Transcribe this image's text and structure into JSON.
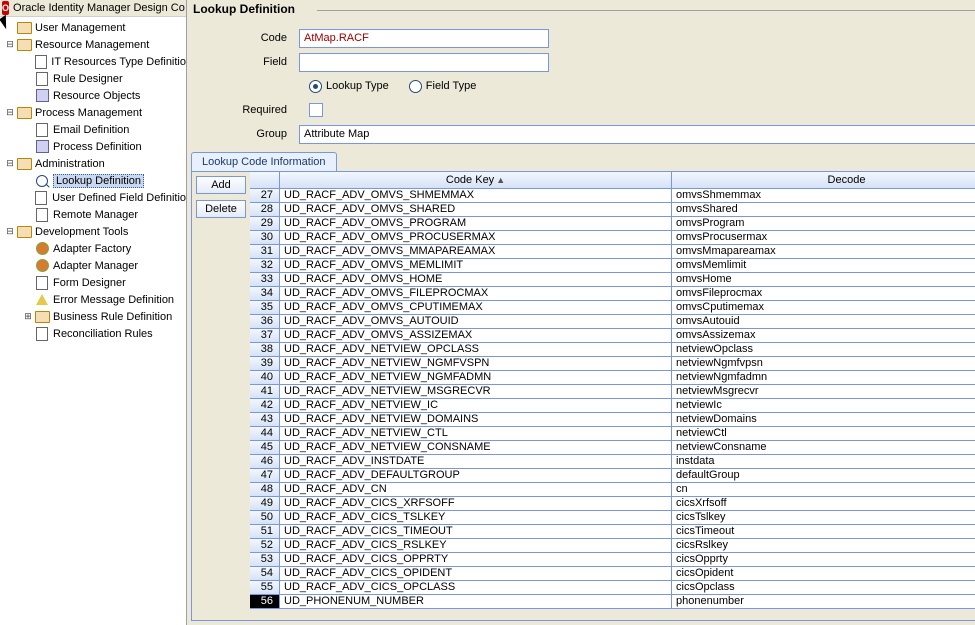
{
  "window": {
    "title": "Oracle Identity Manager Design Co"
  },
  "tree": [
    {
      "type": "folder",
      "label": "User Management",
      "depth": 0,
      "exp": ""
    },
    {
      "type": "folder",
      "label": "Resource Management",
      "depth": 0,
      "exp": "⊟"
    },
    {
      "type": "doc",
      "label": "IT Resources Type Definitio",
      "depth": 1,
      "exp": ""
    },
    {
      "type": "doc",
      "label": "Rule Designer",
      "depth": 1,
      "exp": ""
    },
    {
      "type": "generic",
      "label": "Resource Objects",
      "depth": 1,
      "exp": ""
    },
    {
      "type": "folder",
      "label": "Process Management",
      "depth": 0,
      "exp": "⊟"
    },
    {
      "type": "doc",
      "label": "Email Definition",
      "depth": 1,
      "exp": ""
    },
    {
      "type": "generic",
      "label": "Process Definition",
      "depth": 1,
      "exp": ""
    },
    {
      "type": "folder",
      "label": "Administration",
      "depth": 0,
      "exp": "⊟"
    },
    {
      "type": "magnify",
      "label": "Lookup Definition",
      "depth": 1,
      "exp": "",
      "selected": true
    },
    {
      "type": "doc",
      "label": "User Defined Field Definitio",
      "depth": 1,
      "exp": ""
    },
    {
      "type": "doc",
      "label": "Remote Manager",
      "depth": 1,
      "exp": ""
    },
    {
      "type": "folder",
      "label": "Development Tools",
      "depth": 0,
      "exp": "⊟"
    },
    {
      "type": "gear",
      "label": "Adapter Factory",
      "depth": 1,
      "exp": ""
    },
    {
      "type": "gear",
      "label": "Adapter Manager",
      "depth": 1,
      "exp": ""
    },
    {
      "type": "doc",
      "label": "Form Designer",
      "depth": 1,
      "exp": ""
    },
    {
      "type": "warn",
      "label": "Error Message Definition",
      "depth": 1,
      "exp": ""
    },
    {
      "type": "folder",
      "label": "Business Rule Definition",
      "depth": 1,
      "exp": "⊞"
    },
    {
      "type": "doc",
      "label": "Reconciliation Rules",
      "depth": 1,
      "exp": ""
    }
  ],
  "panel": {
    "title": "Lookup Definition",
    "labels": {
      "code": "Code",
      "field": "Field",
      "lookup_type": "Lookup Type",
      "field_type": "Field Type",
      "required": "Required",
      "group": "Group"
    },
    "values": {
      "code": "AtMap.RACF",
      "field": "",
      "type_selected": "lookup",
      "required": false,
      "group": "Attribute Map"
    },
    "tab": "Lookup Code Information",
    "buttons": {
      "add": "Add",
      "delete": "Delete"
    },
    "columns": {
      "codekey": "Code Key",
      "decode": "Decode",
      "sort": "▲"
    }
  },
  "rows": [
    {
      "n": 27,
      "k": "UD_RACF_ADV_OMVS_SHMEMMAX",
      "d": "omvsShmemmax"
    },
    {
      "n": 28,
      "k": "UD_RACF_ADV_OMVS_SHARED",
      "d": "omvsShared"
    },
    {
      "n": 29,
      "k": "UD_RACF_ADV_OMVS_PROGRAM",
      "d": "omvsProgram"
    },
    {
      "n": 30,
      "k": "UD_RACF_ADV_OMVS_PROCUSERMAX",
      "d": "omvsProcusermax"
    },
    {
      "n": 31,
      "k": "UD_RACF_ADV_OMVS_MMAPAREAMAX",
      "d": "omvsMmapareamax"
    },
    {
      "n": 32,
      "k": "UD_RACF_ADV_OMVS_MEMLIMIT",
      "d": "omvsMemlimit"
    },
    {
      "n": 33,
      "k": "UD_RACF_ADV_OMVS_HOME",
      "d": "omvsHome"
    },
    {
      "n": 34,
      "k": "UD_RACF_ADV_OMVS_FILEPROCMAX",
      "d": "omvsFileprocmax"
    },
    {
      "n": 35,
      "k": "UD_RACF_ADV_OMVS_CPUTIMEMAX",
      "d": "omvsCputimemax"
    },
    {
      "n": 36,
      "k": "UD_RACF_ADV_OMVS_AUTOUID",
      "d": "omvsAutouid"
    },
    {
      "n": 37,
      "k": "UD_RACF_ADV_OMVS_ASSIZEMAX",
      "d": "omvsAssizemax"
    },
    {
      "n": 38,
      "k": "UD_RACF_ADV_NETVIEW_OPCLASS",
      "d": "netviewOpclass"
    },
    {
      "n": 39,
      "k": "UD_RACF_ADV_NETVIEW_NGMFVSPN",
      "d": "netviewNgmfvpsn"
    },
    {
      "n": 40,
      "k": "UD_RACF_ADV_NETVIEW_NGMFADMN",
      "d": "netviewNgmfadmn"
    },
    {
      "n": 41,
      "k": "UD_RACF_ADV_NETVIEW_MSGRECVR",
      "d": "netviewMsgrecvr"
    },
    {
      "n": 42,
      "k": "UD_RACF_ADV_NETVIEW_IC",
      "d": "netviewIc"
    },
    {
      "n": 43,
      "k": "UD_RACF_ADV_NETVIEW_DOMAINS",
      "d": "netviewDomains"
    },
    {
      "n": 44,
      "k": "UD_RACF_ADV_NETVIEW_CTL",
      "d": "netviewCtl"
    },
    {
      "n": 45,
      "k": "UD_RACF_ADV_NETVIEW_CONSNAME",
      "d": "netviewConsname"
    },
    {
      "n": 46,
      "k": "UD_RACF_ADV_INSTDATE",
      "d": "instdata"
    },
    {
      "n": 47,
      "k": "UD_RACF_ADV_DEFAULTGROUP",
      "d": "defaultGroup"
    },
    {
      "n": 48,
      "k": "UD_RACF_ADV_CN",
      "d": "cn"
    },
    {
      "n": 49,
      "k": "UD_RACF_ADV_CICS_XRFSOFF",
      "d": "cicsXrfsoff"
    },
    {
      "n": 50,
      "k": "UD_RACF_ADV_CICS_TSLKEY",
      "d": "cicsTslkey"
    },
    {
      "n": 51,
      "k": "UD_RACF_ADV_CICS_TIMEOUT",
      "d": "cicsTimeout"
    },
    {
      "n": 52,
      "k": "UD_RACF_ADV_CICS_RSLKEY",
      "d": "cicsRslkey"
    },
    {
      "n": 53,
      "k": "UD_RACF_ADV_CICS_OPPRTY",
      "d": "cicsOpprty"
    },
    {
      "n": 54,
      "k": "UD_RACF_ADV_CICS_OPIDENT",
      "d": "cicsOpident"
    },
    {
      "n": 55,
      "k": "UD_RACF_ADV_CICS_OPCLASS",
      "d": "cicsOpclass"
    },
    {
      "n": 56,
      "k": "UD_PHONENUM_NUMBER",
      "d": "phonenumber",
      "selected": true
    }
  ]
}
